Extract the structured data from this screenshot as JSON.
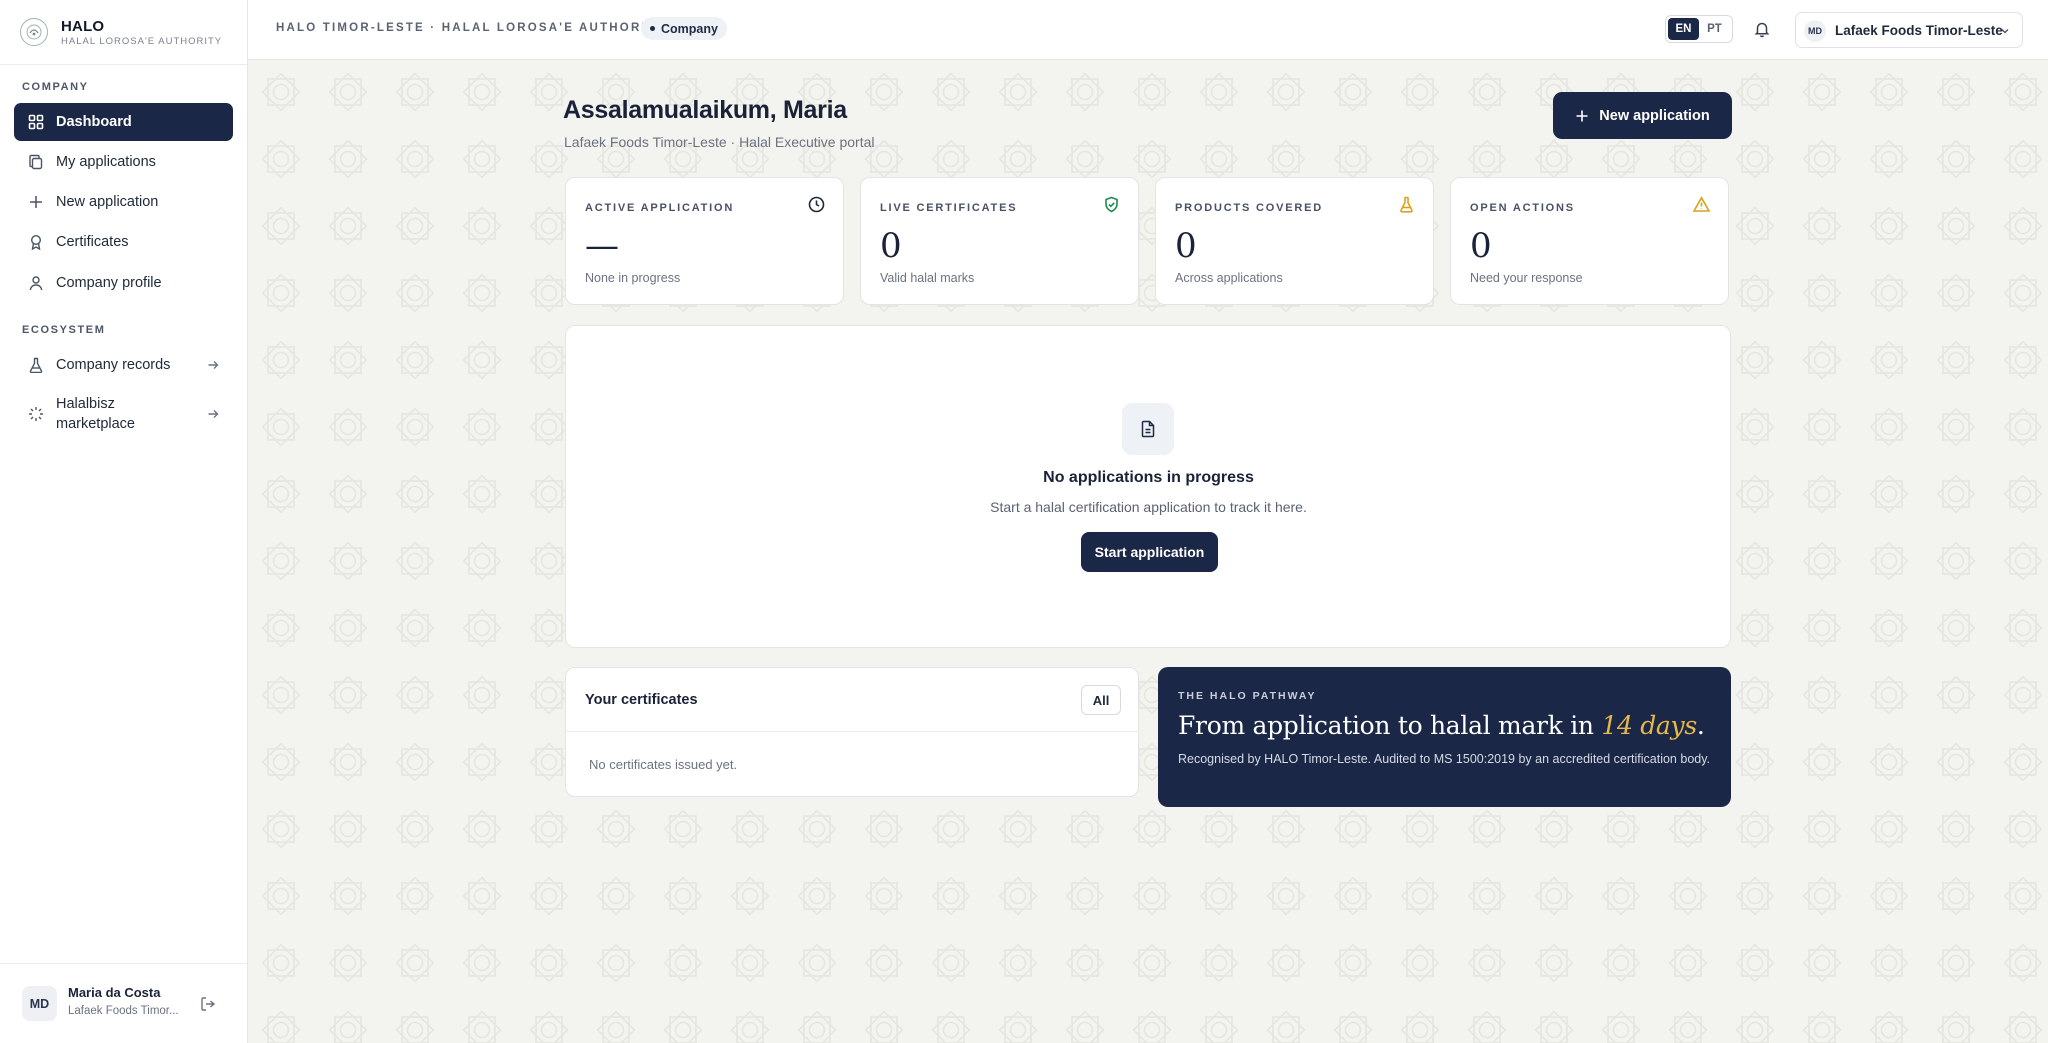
{
  "brand": {
    "name": "HALO",
    "subtitle": "HALAL LOROSA'E AUTHORITY"
  },
  "sidebar": {
    "sections": [
      {
        "label": "COMPANY",
        "items": [
          {
            "label": "Dashboard",
            "icon": "dashboard-icon",
            "active": true
          },
          {
            "label": "My applications",
            "icon": "copy-icon"
          },
          {
            "label": "New application",
            "icon": "plus-icon"
          },
          {
            "label": "Certificates",
            "icon": "award-icon"
          },
          {
            "label": "Company profile",
            "icon": "user-icon"
          }
        ]
      },
      {
        "label": "ECOSYSTEM",
        "items": [
          {
            "label": "Company records",
            "icon": "flask-icon",
            "external": true
          },
          {
            "label": "Halalbisz marketplace",
            "icon": "loader-icon",
            "external": true
          }
        ]
      }
    ],
    "user": {
      "initials": "MD",
      "name": "Maria da Costa",
      "company": "Lafaek Foods Timor..."
    }
  },
  "topbar": {
    "title": "HALO TIMOR-LESTE · HALAL LOROSA'E AUTHORITY",
    "role_badge": "Company",
    "languages": [
      "EN",
      "PT"
    ],
    "active_language": "EN",
    "company_initials": "MD",
    "company_name": "Lafaek Foods Timor-Leste"
  },
  "header": {
    "greeting": "Assalamualaikum, Maria",
    "subtitle": "Lafaek Foods Timor-Leste · Halal Executive portal",
    "new_application_label": "New application"
  },
  "stats": [
    {
      "label": "ACTIVE APPLICATION",
      "value": "—",
      "sub": "None in progress",
      "icon": "clock-icon",
      "color": "#1f2937"
    },
    {
      "label": "LIVE CERTIFICATES",
      "value": "0",
      "sub": "Valid halal marks",
      "icon": "shield-check-icon",
      "color": "#1f8a4c"
    },
    {
      "label": "PRODUCTS COVERED",
      "value": "0",
      "sub": "Across applications",
      "icon": "flask-icon",
      "color": "#d9a21b"
    },
    {
      "label": "OPEN ACTIONS",
      "value": "0",
      "sub": "Need your response",
      "icon": "warning-icon",
      "color": "#d9a21b"
    }
  ],
  "empty_state": {
    "title": "No applications in progress",
    "text": "Start a halal certification application to track it here.",
    "button": "Start application",
    "icon": "document-icon"
  },
  "certificates": {
    "title": "Your certificates",
    "all_label": "All",
    "empty": "No certificates issued yet."
  },
  "pathway": {
    "label": "THE HALO PATHWAY",
    "headline_pre": "From application to halal mark in ",
    "headline_highlight": "14 days",
    "headline_post": ".",
    "text": "Recognised by HALO Timor-Leste. Audited to MS 1500:2019 by an accredited certification body."
  },
  "colors": {
    "primary": "#1b2747",
    "accent": "#e8b84a",
    "success": "#1f8a4c",
    "warning": "#d9a21b",
    "background": "#f3f3ef"
  }
}
